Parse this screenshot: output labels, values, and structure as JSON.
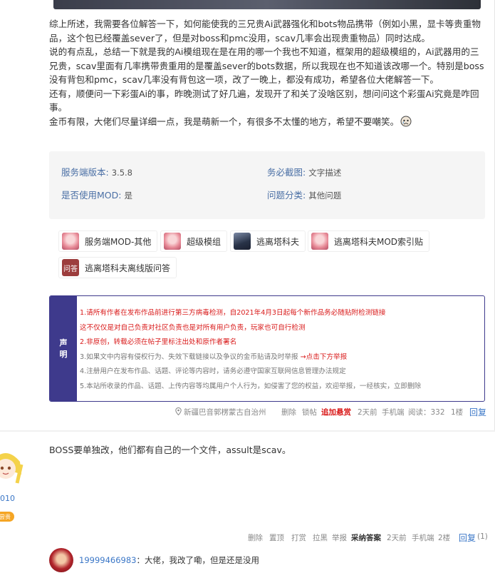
{
  "post": {
    "paragraphs": [
      "综上所述，我需要各位解答一下，如何能使我的三兄贵Ai武器强化和bots物品携带（例如小黑，显卡等贵重物品，这个包已经覆盖sever了，但是对boss和pmc没用，scav几率会出现贵重物品）同时达成。",
      "说的有点乱，总结一下就是我的Ai模组现在是在用的哪一个我也不知道，框架用的超级模组的，Ai武器用的三兄贵，scav里面有几率携带贵重用的是覆盖sever的bots数据，所以我现在也不知道该改哪一个。特别是boss没有背包和pmc，scav几率没有背包这一项，改了一晚上，都没有成功，希望各位大佬解答一下。",
      "还有，顺便问一下彩蛋Ai的事，昨晚测试了好几遍，发现开了和关了没啥区别，想问问这个彩蛋Ai究竟是咋回事。",
      "金币有限，大佬们尽量详细一点，我是萌新一个，有很多不太懂的地方，希望不要嘲笑。"
    ],
    "emoji_icon": "crying-face-icon"
  },
  "info": {
    "server_version_label": "服务端版本:",
    "server_version_value": "3.5.8",
    "screenshot_label": "务必截图:",
    "screenshot_value": "文字描述",
    "mod_label": "是否使用MOD:",
    "mod_value": "是",
    "category_label": "问题分类:",
    "category_value": "其他问题"
  },
  "tags": [
    {
      "label": "服务端MOD-其他"
    },
    {
      "label": "超级模组"
    },
    {
      "label": "逃离塔科夫"
    },
    {
      "label": "逃离塔科夫MOD索引贴"
    },
    {
      "label": "逃离塔科夫离线版问答",
      "avatar_text": "问答"
    }
  ],
  "notice": {
    "side_line1": "声",
    "side_line2": "明",
    "line1": "1.请所有作者在发布作品前进行第三方病毒检测，自2021年4月3日起每个新作品务必随贴附检测链接",
    "line1b": "这不仅仅是对自己负责对社区负责也是对所有用户负责，玩家也可自行检测",
    "line2": "2.非原创，转载必须在帖子里标注出处和原作者署名",
    "line3a": "3.如果文中内容有侵权行为、失效下载链接以及争议的金币贴请及时举报 ",
    "line3b": "→点击下方举报",
    "line4": "4.注册用户在发布作品、话题、评论等内容时，请务必遵守国家互联网信息管理办法规定",
    "line5": "5.本站所收录的作品、话题、上传内容等均属用户个人行为，如侵害了您的权益，欢迎举报，一经核实，立即删除"
  },
  "post_meta": {
    "location": "新疆巴音郭楞蒙古自治州",
    "delete": "删除",
    "lock": "锁帖",
    "reward": "追加悬赏",
    "time": "2天前",
    "device": "手机端",
    "views": "阅读：332",
    "floor": "1楼",
    "reply": "回复"
  },
  "reply": {
    "user_number": "010",
    "badge": "尝贵",
    "text": "BOSS要单独改，他们都有自己的一个文件，assult是scav。",
    "meta": {
      "delete": "删除",
      "top": "置顶",
      "tip": "打赏",
      "hide": "拉黑",
      "report": "举报",
      "best": "采纳答案",
      "time": "2天前",
      "device": "手机端",
      "floor": "2楼",
      "reply": "回复",
      "count": "(1)"
    }
  },
  "sub_reply": {
    "user": "19999466983",
    "text": "：大佬，我改了嘞，但是还是没用"
  }
}
